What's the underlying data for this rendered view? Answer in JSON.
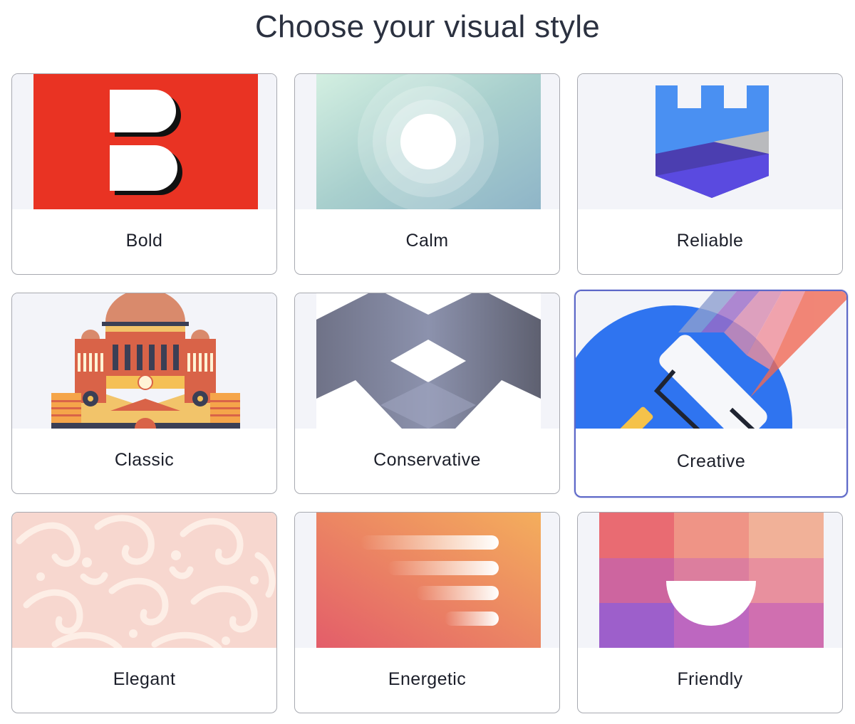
{
  "page": {
    "title": "Choose your visual style"
  },
  "styles": [
    {
      "label": "Bold"
    },
    {
      "label": "Calm"
    },
    {
      "label": "Reliable"
    },
    {
      "label": "Classic"
    },
    {
      "label": "Conservative"
    },
    {
      "label": "Creative",
      "selected": true
    },
    {
      "label": "Elegant"
    },
    {
      "label": "Energetic"
    },
    {
      "label": "Friendly"
    }
  ],
  "colors": {
    "selected_border": "#5d68c8",
    "card_border": "#a7a9b0",
    "art_background": "#f3f4f9"
  }
}
